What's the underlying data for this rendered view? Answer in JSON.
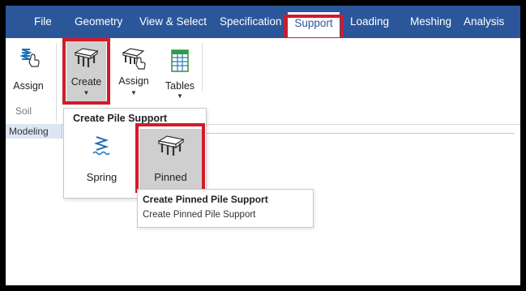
{
  "menubar": {
    "items": [
      {
        "label": "File"
      },
      {
        "label": "Geometry"
      },
      {
        "label": "View & Select"
      },
      {
        "label": "Specification"
      },
      {
        "label": "Support"
      },
      {
        "label": "Loading"
      },
      {
        "label": "Meshing"
      },
      {
        "label": "Analysis"
      }
    ],
    "active_item": "Support",
    "bg_color": "#2b579a"
  },
  "ribbon": {
    "buttons": [
      {
        "label": "Assign",
        "icon": "spring-assign-icon",
        "group": "Soil"
      },
      {
        "label": "Create",
        "icon": "pile-cap-icon",
        "has_dropdown": true,
        "state": "pressed"
      },
      {
        "label": "Assign",
        "icon": "pile-assign-icon",
        "has_dropdown": true
      },
      {
        "label": "Tables",
        "icon": "table-icon",
        "has_dropdown": true
      }
    ],
    "groups": [
      {
        "label": "Soil"
      }
    ]
  },
  "doc_tabs": [
    {
      "label": "Modeling"
    }
  ],
  "dropdown": {
    "title": "Create Pile Support",
    "items": [
      {
        "label": "Spring",
        "icon": "spring-icon"
      },
      {
        "label": "Pinned",
        "icon": "pinned-pile-icon",
        "state": "highlighted"
      }
    ]
  },
  "tooltip": {
    "title": "Create Pinned Pile Support",
    "body": "Create Pinned Pile Support"
  },
  "colors": {
    "highlight_box": "#d11b2a",
    "pressed_bg": "#cfcfcf",
    "accent": "#2b579a"
  }
}
